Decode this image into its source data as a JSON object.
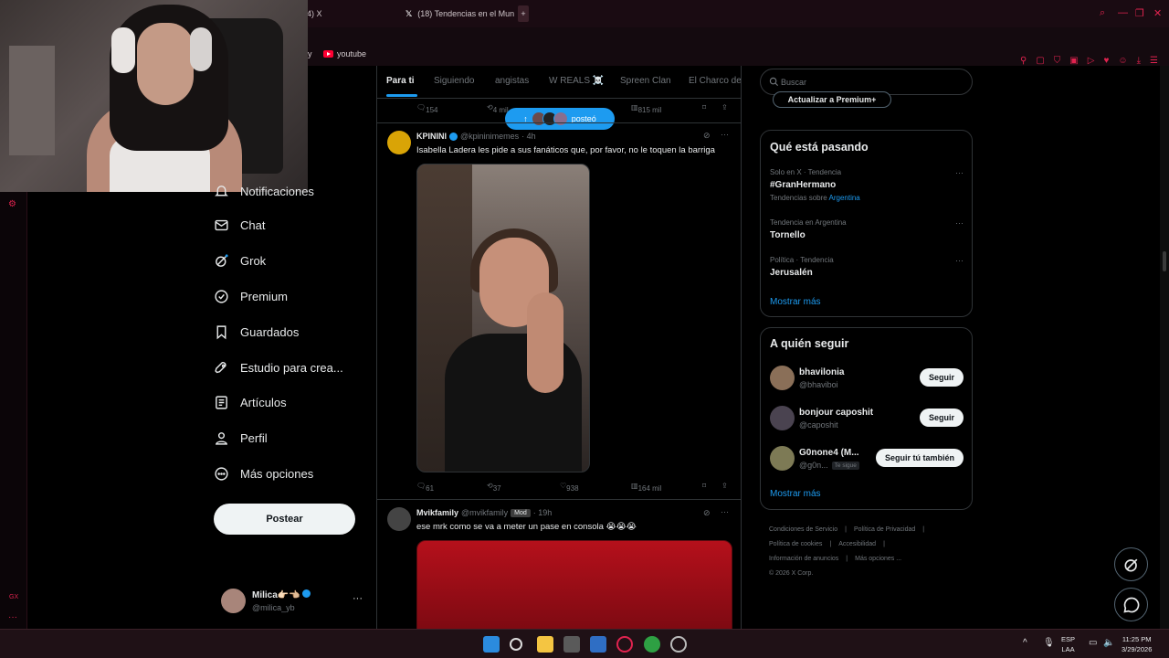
{
  "browser": {
    "tabs": [
      {
        "label": "4) X"
      },
      {
        "label": "(18) Tendencias en el Mun"
      }
    ],
    "new_tab_glyph": "+",
    "bookmarks": [
      {
        "label": "y"
      },
      {
        "label": "youtube"
      }
    ]
  },
  "nav": {
    "items": [
      {
        "label": "Notificaciones",
        "icon": "bell-icon"
      },
      {
        "label": "Chat",
        "icon": "mail-icon"
      },
      {
        "label": "Grok",
        "icon": "grok-icon"
      },
      {
        "label": "Premium",
        "icon": "premium-icon"
      },
      {
        "label": "Guardados",
        "icon": "bookmark-icon"
      },
      {
        "label": "Estudio para crea...",
        "icon": "rocket-icon"
      },
      {
        "label": "Artículos",
        "icon": "article-icon"
      },
      {
        "label": "Perfil",
        "icon": "person-icon"
      },
      {
        "label": "Más opciones",
        "icon": "more-circle-icon"
      }
    ],
    "post_button": "Postear",
    "account": {
      "name": "Milica👉🏻👈🏼",
      "handle": "@milica_yb",
      "more": "···"
    }
  },
  "timeline": {
    "tabs": [
      "Para ti",
      "Siguiendo",
      "angistas",
      "W REALS ☠️",
      "Spreen Clan",
      "El Charco de"
    ],
    "active_tab": "Para ti",
    "posted_pill": "posteó",
    "prev_actions": {
      "replies": "154",
      "reposts": "4 mil",
      "views": "815 mil"
    },
    "tweets": [
      {
        "name": "KPININI",
        "handle": "@kpininimemes",
        "time": "· 4h",
        "text": "Isabella Ladera les pide a sus fanáticos que, por favor, no le toquen la barriga",
        "replies": "61",
        "reposts": "37",
        "likes": "938",
        "views": "164 mil"
      },
      {
        "name": "Mvikfamily",
        "handle": "@mvikfamily",
        "badge": "Mod",
        "time": "· 19h",
        "text": "ese mrk como se va a meter un pase en consola 😭😭😭"
      }
    ]
  },
  "sidebar": {
    "search_placeholder": "Buscar",
    "premium_button": "Actualizar a Premium+",
    "trends": {
      "title": "Qué está pasando",
      "items": [
        {
          "meta": "Solo en X · Tendencia",
          "name": "#GranHermano",
          "sub_prefix": "Tendencias sobre",
          "sub_link": "Argentina"
        },
        {
          "meta": "Tendencia en Argentina",
          "name": "Tornello"
        },
        {
          "meta": "Política · Tendencia",
          "name": "Jerusalén"
        }
      ],
      "show_more": "Mostrar más"
    },
    "who_to_follow": {
      "title": "A quién seguir",
      "items": [
        {
          "name": "bhavilonia",
          "handle": "@bhaviboi",
          "button": "Seguir"
        },
        {
          "name": "bonjour caposhit",
          "handle": "@caposhit",
          "button": "Seguir"
        },
        {
          "name": "G0none4 (M...",
          "handle": "@g0n...",
          "follows_you": "Te sigue",
          "button": "Seguir tú también"
        }
      ],
      "show_more": "Mostrar más"
    },
    "footer": [
      "Condiciones de Servicio",
      "|",
      "Política de Privacidad",
      "|",
      "Política de cookies",
      "|",
      "Accesibilidad",
      "|",
      "Información de anuncios",
      "|",
      "Más opciones ...",
      "© 2026 X Corp."
    ]
  },
  "taskbar": {
    "lang": "ESP",
    "lang2": "LAA",
    "time": "11:25 PM",
    "date": "3/29/2026"
  },
  "colors": {
    "accent": "#1d9bf0",
    "browser_accent": "#e0234f",
    "background": "#000000"
  }
}
